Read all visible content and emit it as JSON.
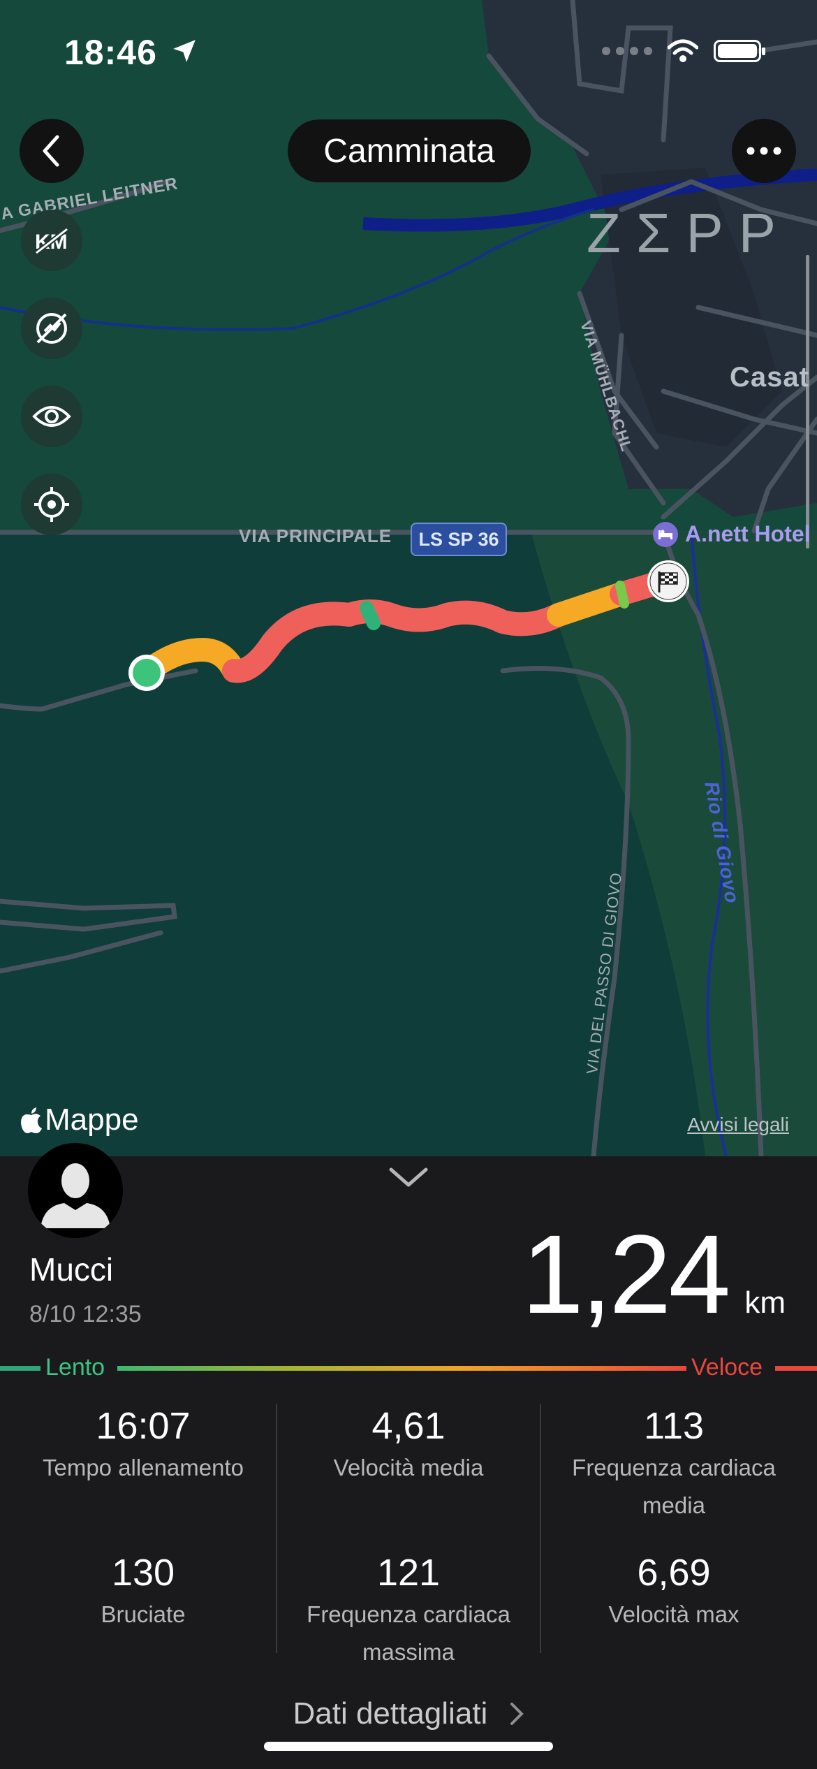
{
  "status_bar": {
    "time": "18:46"
  },
  "header": {
    "title": "Camminata"
  },
  "map": {
    "brand_watermark": "ZΣPP",
    "attribution": "Mappe",
    "legal_link": "Avvisi legali",
    "labels": {
      "street_gabriel": "IA GABRIEL LEITNER",
      "street_muhlbachl": "VIA MÜHLBACHL",
      "street_principale": "VIA PRINCIPALE",
      "road_shield": "LS SP 36",
      "poi_hotel": "A.nett Hotel",
      "town": "Casat",
      "river": "Rio di Giovo",
      "street_passo": "VIA DEL PASSO DI GIOVO"
    },
    "tools": [
      "km-markers-icon",
      "hide-pace-icon",
      "eye-icon",
      "locate-icon"
    ]
  },
  "workout": {
    "user_name": "Mucci",
    "date": "8/10 12:35",
    "distance": "1,24",
    "distance_unit": "km"
  },
  "speed_legend": {
    "slow": "Lento",
    "fast": "Veloce"
  },
  "stats": [
    {
      "value": "16:07",
      "label": "Tempo allenamento"
    },
    {
      "value": "4,61",
      "label": "Velocità media"
    },
    {
      "value": "113",
      "label": "Frequenza cardiaca media"
    },
    {
      "value": "130",
      "label": "Bruciate"
    },
    {
      "value": "121",
      "label": "Frequenza cardiaca massima"
    },
    {
      "value": "6,69",
      "label": "Velocità max"
    }
  ],
  "detail_link": "Dati dettagliati",
  "colors": {
    "map_green": "#0e3d38",
    "route_red": "#f0605a",
    "route_orange": "#f6a924",
    "start_green": "#3cc47a"
  }
}
